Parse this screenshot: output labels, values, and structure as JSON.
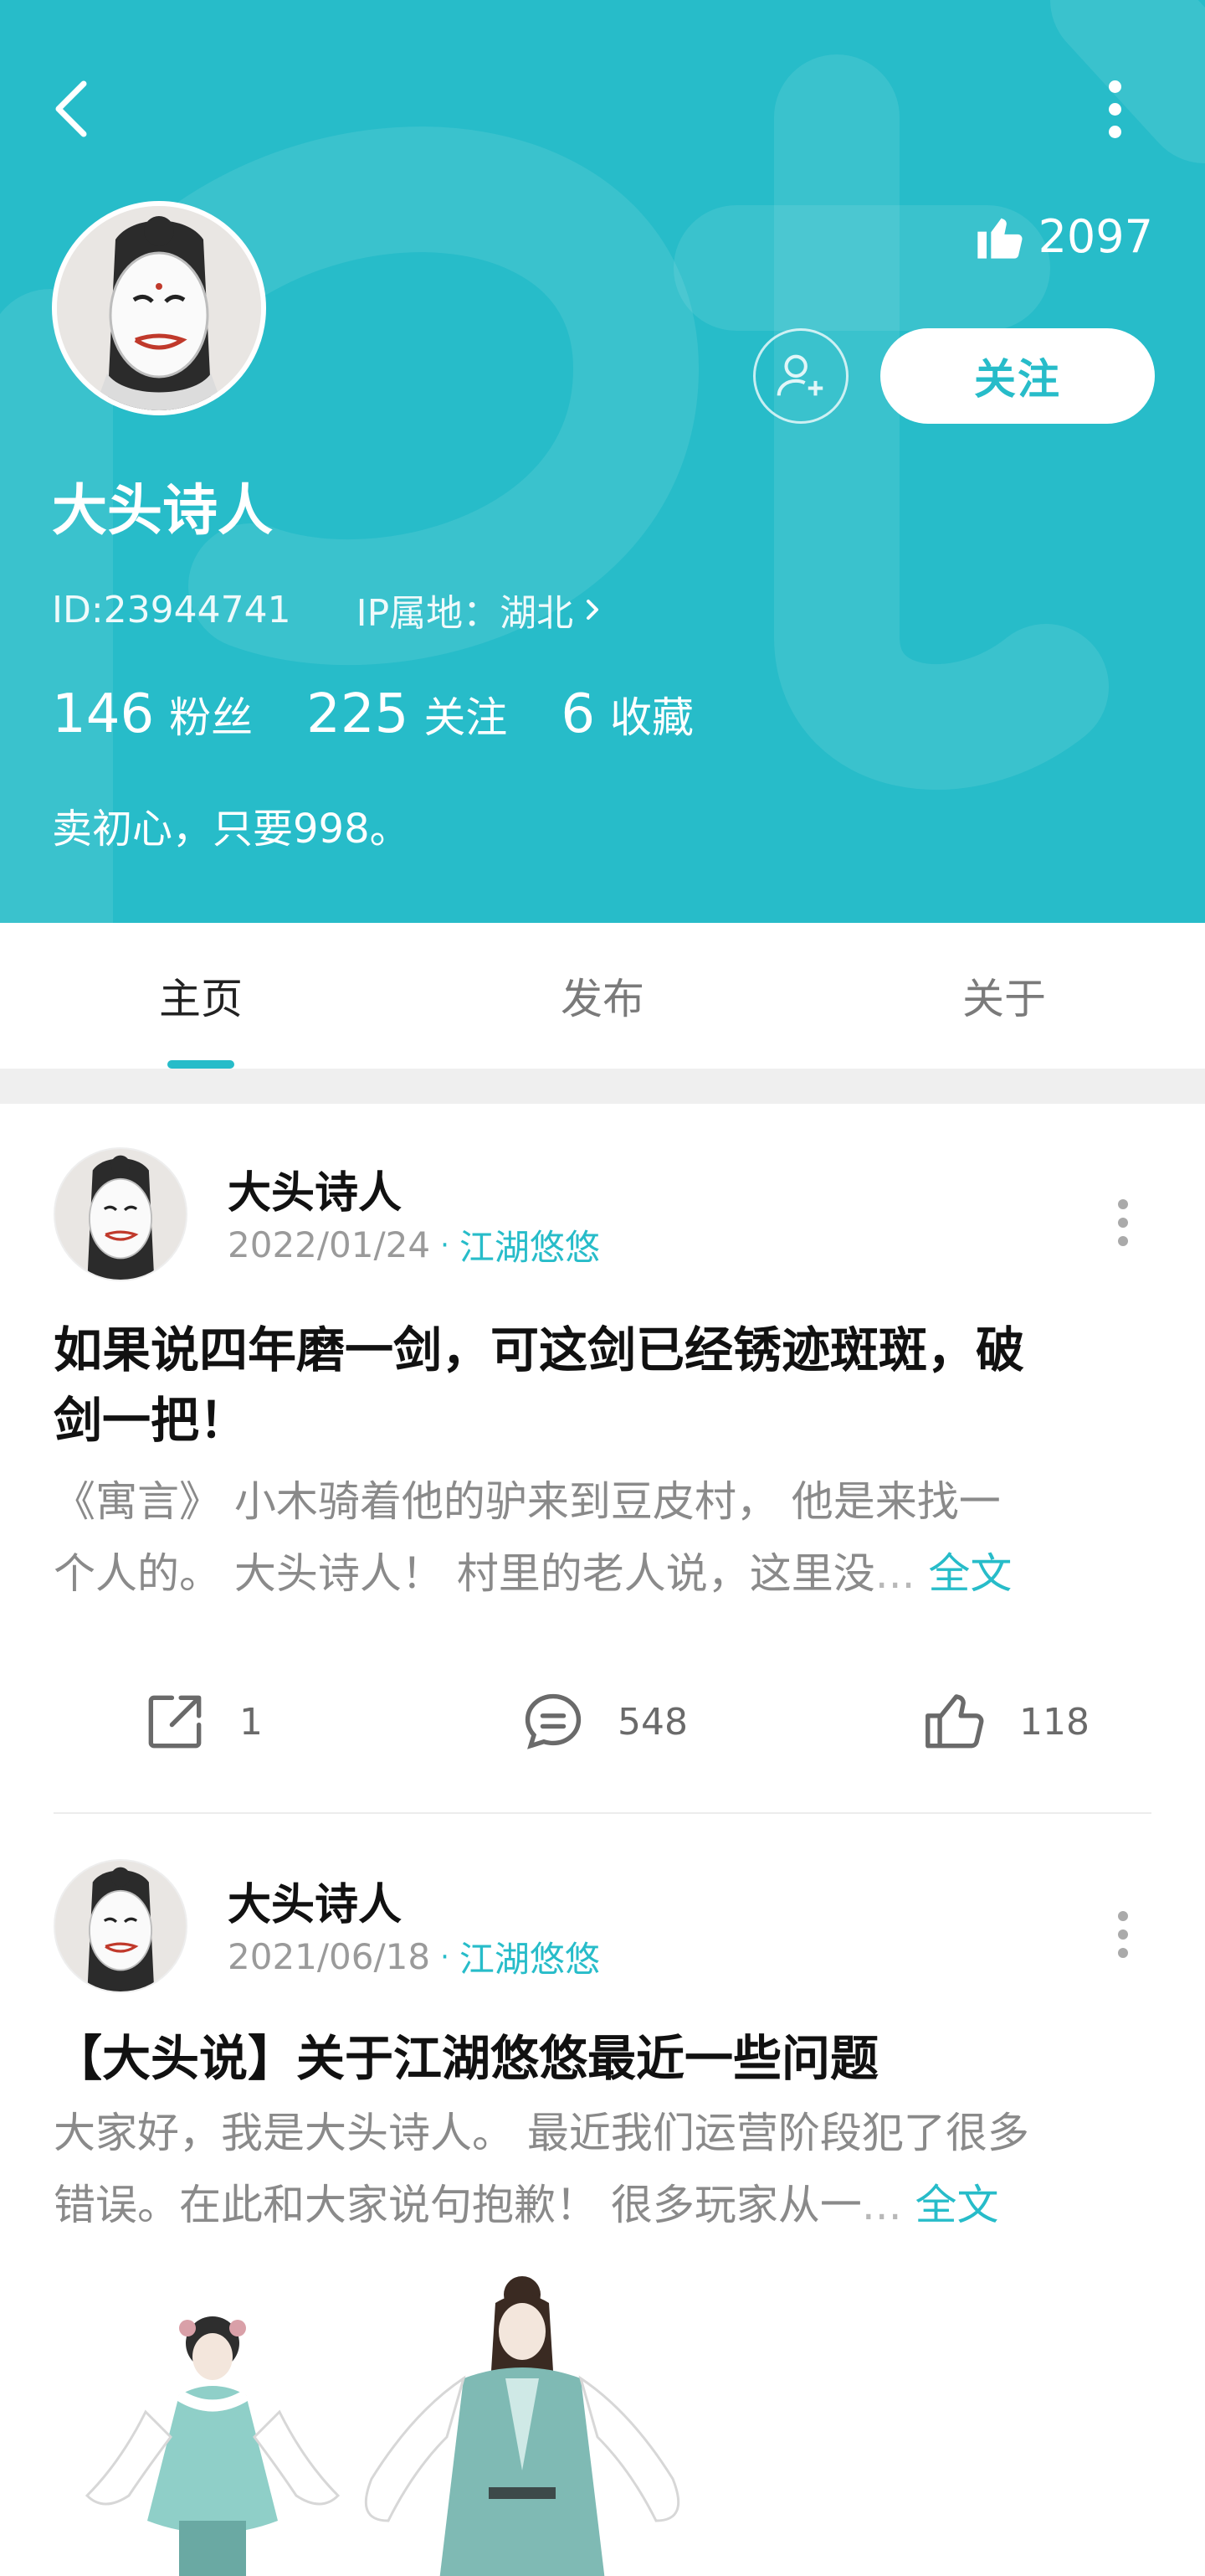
{
  "colors": {
    "accent": "#27bcc9",
    "header_bg": "#27bcc9",
    "muted": "#9a9a9a"
  },
  "header": {
    "back_icon": "chevron-left-icon",
    "more_icon": "vertical-dots-icon",
    "likes": "2097",
    "follow_label": "关注",
    "nickname": "大头诗人",
    "id_text": "ID:23944741",
    "ip_text": "IP属地：湖北",
    "stats": [
      {
        "num": "146",
        "label": "粉丝"
      },
      {
        "num": "225",
        "label": "关注"
      },
      {
        "num": "6",
        "label": "收藏"
      }
    ],
    "bio": "卖初心，只要998。"
  },
  "tabs": [
    {
      "label": "主页",
      "active": true
    },
    {
      "label": "发布",
      "active": false
    },
    {
      "label": "关于",
      "active": false
    }
  ],
  "posts": [
    {
      "author": "大头诗人",
      "date": "2022/01/24",
      "separator": "·",
      "topic": "江湖悠悠",
      "title_line1": "如果说四年磨一剑，可这剑已经锈迹斑斑，破",
      "title_line2": "剑一把！",
      "body_line1": "《寓言》 小木骑着他的驴来到豆皮村， 他是来找一",
      "body_line2": "个人的。 大头诗人！ 村里的老人说，这里没",
      "ellipsis": "...",
      "full_text": "全文",
      "shares": "1",
      "comments": "548",
      "likes": "118"
    },
    {
      "author": "大头诗人",
      "date": "2021/06/18",
      "separator": "·",
      "topic": "江湖悠悠",
      "title_line1": "【大头说】关于江湖悠悠最近一些问题",
      "body_line1": "大家好，我是大头诗人。 最近我们运营阶段犯了很多",
      "body_line2": "错误。在此和大家说句抱歉！ 很多玩家从一",
      "ellipsis": "...",
      "full_text": "全文"
    }
  ]
}
